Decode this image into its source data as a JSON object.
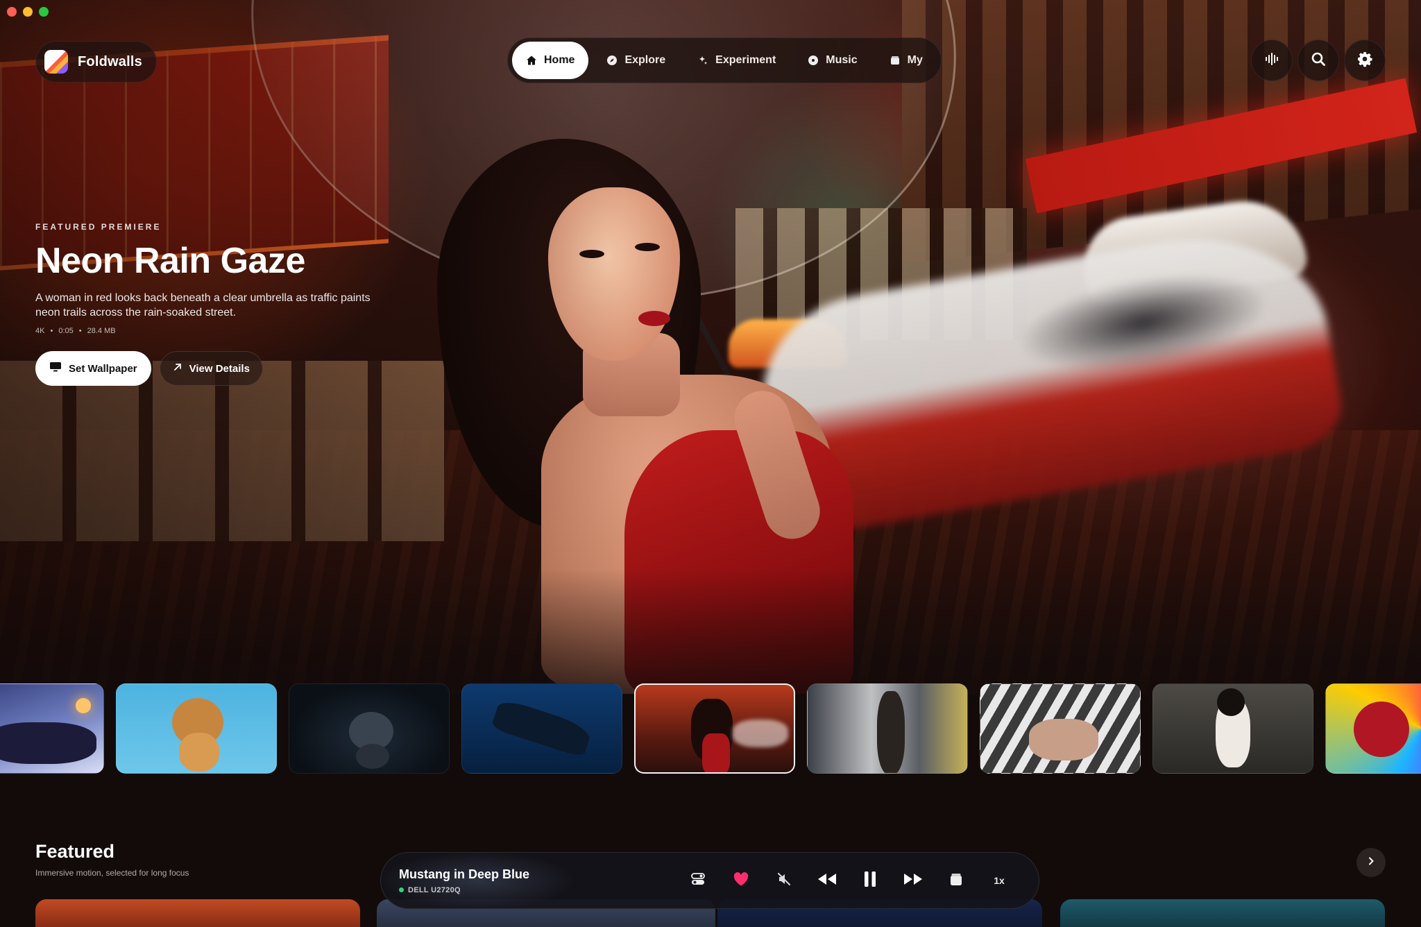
{
  "app": {
    "name": "Foldwalls"
  },
  "nav": {
    "items": [
      {
        "label": "Home",
        "icon": "home-icon",
        "active": true
      },
      {
        "label": "Explore",
        "icon": "compass-icon",
        "active": false
      },
      {
        "label": "Experiment",
        "icon": "sparkle-icon",
        "active": false
      },
      {
        "label": "Music",
        "icon": "music-disc-icon",
        "active": false
      },
      {
        "label": "My",
        "icon": "folder-icon",
        "active": false
      }
    ]
  },
  "toolbar": {
    "buttons": [
      "audio-waveform-icon",
      "search-icon",
      "gear-icon"
    ]
  },
  "hero": {
    "eyebrow": "FEATURED PREMIERE",
    "title": "Neon Rain Gaze",
    "description": "A woman in red looks back beneath a clear umbrella as traffic paints neon trails across the rain-soaked street.",
    "meta": {
      "resolution": "4K",
      "duration": "0:05",
      "size": "28.4 MB",
      "separator": "•"
    },
    "primary_action": "Set Wallpaper",
    "secondary_action": "View Details"
  },
  "thumbnails": [
    {
      "subject": "girl sleeping in snow with lantern",
      "active": false
    },
    {
      "subject": "fluffy puppy on blue",
      "active": false
    },
    {
      "subject": "cartoon cat with cup",
      "active": false
    },
    {
      "subject": "dark car underwater",
      "active": false
    },
    {
      "subject": "neon rain gaze",
      "active": true
    },
    {
      "subject": "woman by subway train",
      "active": false
    },
    {
      "subject": "woman lying in striped light",
      "active": false
    },
    {
      "subject": "woman in white dress",
      "active": false
    },
    {
      "subject": "spider hero neon",
      "active": false
    }
  ],
  "featured": {
    "title": "Featured",
    "subtitle": "Immersive motion, selected for long focus"
  },
  "player": {
    "title": "Mustang in Deep Blue",
    "device": "DELL U2720Q",
    "speed": "1x",
    "liked": true,
    "muted": true,
    "playing": true,
    "controls": [
      "toggle-icon",
      "heart-icon",
      "mute-icon",
      "rewind-icon",
      "pause-icon",
      "fast-forward-icon",
      "folder-icon"
    ]
  },
  "colors": {
    "accent_heart": "#ff2d6f",
    "status_online": "#34d27b",
    "active_nav_bg": "#ffffff",
    "background": "#120b0a"
  }
}
